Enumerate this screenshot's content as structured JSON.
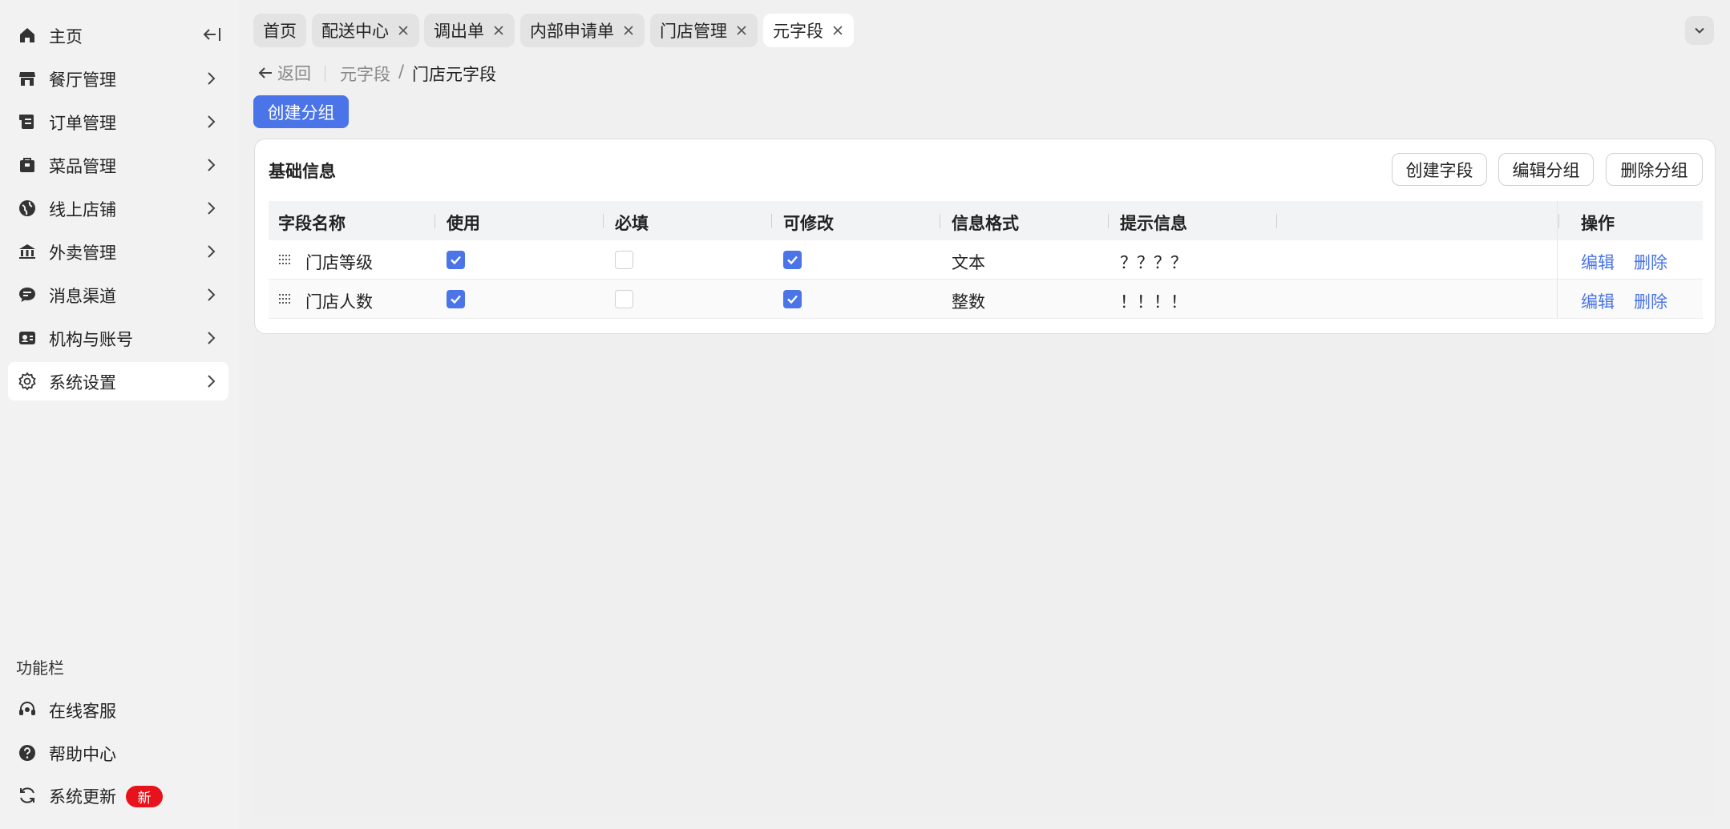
{
  "sidebar": {
    "items": [
      {
        "label": "主页",
        "icon": "home-icon"
      },
      {
        "label": "餐厅管理",
        "icon": "store-icon"
      },
      {
        "label": "订单管理",
        "icon": "order-icon"
      },
      {
        "label": "菜品管理",
        "icon": "dish-icon"
      },
      {
        "label": "线上店铺",
        "icon": "globe-icon"
      },
      {
        "label": "外卖管理",
        "icon": "delivery-icon"
      },
      {
        "label": "消息渠道",
        "icon": "message-icon"
      },
      {
        "label": "机构与账号",
        "icon": "account-icon"
      },
      {
        "label": "系统设置",
        "icon": "gear-icon"
      }
    ],
    "section_label": "功能栏",
    "tools": [
      {
        "label": "在线客服",
        "icon": "headset-icon"
      },
      {
        "label": "帮助中心",
        "icon": "help-icon"
      },
      {
        "label": "系统更新",
        "icon": "refresh-icon",
        "badge": "新"
      }
    ]
  },
  "tabs": [
    {
      "label": "首页",
      "closable": false
    },
    {
      "label": "配送中心",
      "closable": true
    },
    {
      "label": "调出单",
      "closable": true
    },
    {
      "label": "内部申请单",
      "closable": true
    },
    {
      "label": "门店管理",
      "closable": true
    },
    {
      "label": "元字段",
      "closable": true,
      "active": true
    }
  ],
  "breadcrumb": {
    "back": "返回",
    "parent": "元字段",
    "separator": "/",
    "current": "门店元字段"
  },
  "create_group_button": "创建分组",
  "card": {
    "title": "基础信息",
    "actions": {
      "create_field": "创建字段",
      "edit_group": "编辑分组",
      "delete_group": "删除分组"
    },
    "columns": [
      "字段名称",
      "使用",
      "必填",
      "可修改",
      "信息格式",
      "提示信息",
      "操作"
    ],
    "rows": [
      {
        "name": "门店等级",
        "use": true,
        "required": false,
        "editable": true,
        "format": "文本",
        "hint": "？？？？",
        "edit": "编辑",
        "delete": "删除"
      },
      {
        "name": "门店人数",
        "use": true,
        "required": false,
        "editable": true,
        "format": "整数",
        "hint": "！！！！",
        "edit": "编辑",
        "delete": "删除"
      }
    ]
  },
  "colors": {
    "accent": "#4a74e8",
    "badge": "#e8121c"
  }
}
